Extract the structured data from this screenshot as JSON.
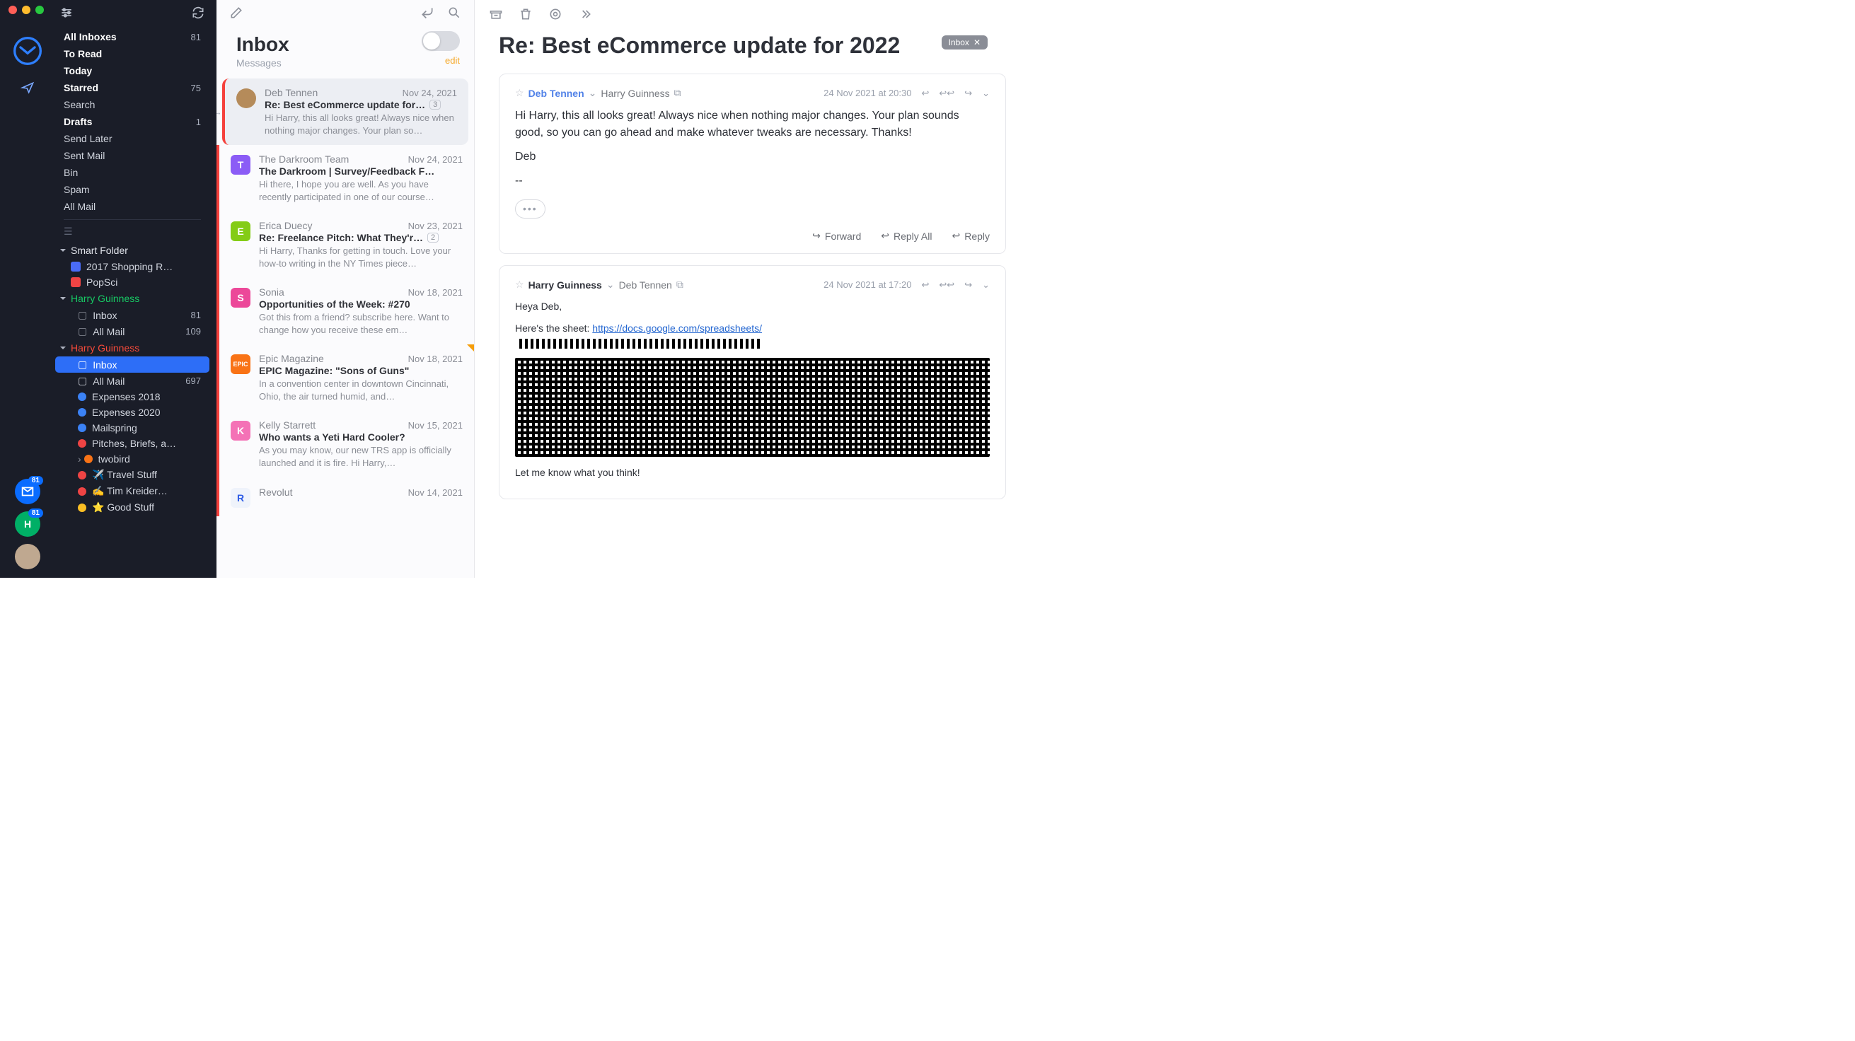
{
  "rail": {
    "badges": {
      "top": "81",
      "mid": "81"
    },
    "mid_avatar_initial": "H"
  },
  "sidebar": {
    "top": [
      {
        "label": "All Inboxes",
        "count": "81",
        "bold": true
      },
      {
        "label": "To Read",
        "count": "",
        "bold": true
      },
      {
        "label": "Today",
        "count": "",
        "bold": true
      },
      {
        "label": "Starred",
        "count": "75",
        "bold": true
      },
      {
        "label": "Search",
        "count": "",
        "bold": false
      },
      {
        "label": "Drafts",
        "count": "1",
        "bold": true
      },
      {
        "label": "Send Later",
        "count": "",
        "bold": false
      },
      {
        "label": "Sent Mail",
        "count": "",
        "bold": false
      },
      {
        "label": "Bin",
        "count": "",
        "bold": false
      },
      {
        "label": "Spam",
        "count": "",
        "bold": false
      },
      {
        "label": "All Mail",
        "count": "",
        "bold": false
      }
    ],
    "smart_label": "Smart Folder",
    "smart": [
      {
        "label": "2017 Shopping R…",
        "color": "sf-blue"
      },
      {
        "label": "PopSci",
        "color": "sf-red"
      }
    ],
    "acct1": {
      "name": "Harry Guinness",
      "items": [
        {
          "label": "Inbox",
          "count": "81"
        },
        {
          "label": "All Mail",
          "count": "109"
        }
      ]
    },
    "acct2": {
      "name": "Harry Guinness",
      "items": [
        {
          "label": "Inbox",
          "count": "",
          "selected": true
        },
        {
          "label": "All Mail",
          "count": "697"
        }
      ],
      "tags": [
        {
          "dot": "d-blue",
          "label": "Expenses 2018"
        },
        {
          "dot": "d-blue",
          "label": "Expenses 2020"
        },
        {
          "dot": "d-blue",
          "label": "Mailspring"
        },
        {
          "dot": "d-red",
          "label": "Pitches, Briefs, a…"
        },
        {
          "dot": "d-orange",
          "label": "twobird",
          "expandable": true
        },
        {
          "dot": "d-red",
          "label": "✈️ Travel Stuff"
        },
        {
          "dot": "d-red",
          "label": "✍️ Tim Kreider…"
        },
        {
          "dot": "d-yellow",
          "label": "⭐️ Good Stuff"
        }
      ]
    }
  },
  "list": {
    "title": "Inbox",
    "subtitle": "Messages",
    "edit": "edit",
    "messages": [
      {
        "from": "Deb Tennen",
        "date": "Nov 24, 2021",
        "subj": "Re: Best eCommerce update for…",
        "count": "3",
        "prev": "Hi Harry, this all looks great! Always nice when nothing major changes. Your plan so…",
        "avatar": "img",
        "color": "#b58b5a",
        "selected": true
      },
      {
        "from": "The Darkroom Team",
        "date": "Nov 24, 2021",
        "subj": "The Darkroom | Survey/Feedback F…",
        "prev": "Hi there, I hope you are well. As you have recently participated in one of our course…",
        "avatar": "T",
        "color": "#8b5cf6"
      },
      {
        "from": "Erica Duecy",
        "date": "Nov 23, 2021",
        "subj": "Re: Freelance Pitch: What They'r…",
        "count": "2",
        "prev": "Hi Harry, Thanks for getting in touch. Love your how-to writing in the NY Times piece…",
        "avatar": "E",
        "color": "#84cc16"
      },
      {
        "from": "Sonia",
        "date": "Nov 18, 2021",
        "subj": "Opportunities of the Week: #270",
        "prev": "Got this from a friend? subscribe here. Want to change how you receive these em…",
        "avatar": "S",
        "color": "#ec4899"
      },
      {
        "from": "Epic Magazine",
        "date": "Nov 18, 2021",
        "subj": "EPIC Magazine: \"Sons of Guns\"",
        "prev": "In a convention center in downtown Cincinnati, Ohio, the air turned humid, and…",
        "avatar": "EPIC",
        "color": "#f97316",
        "small": true,
        "flag": true
      },
      {
        "from": "Kelly Starrett",
        "date": "Nov 15, 2021",
        "subj": "Who wants a Yeti Hard Cooler?",
        "prev": "As you may know, our new TRS app is officially launched and it is fire. Hi Harry,…",
        "avatar": "K",
        "color": "#f472b6"
      },
      {
        "from": "Revolut",
        "date": "Nov 14, 2021",
        "subj": "",
        "prev": "",
        "avatar": "R",
        "color": "#eff3fb",
        "textcolor": "#2e5ce6"
      }
    ]
  },
  "reader": {
    "subject": "Re: Best eCommerce update for 2022",
    "chip": "Inbox",
    "emails": [
      {
        "sender": "Deb Tennen",
        "recipient": "Harry Guinness",
        "date": "24 Nov 2021 at 20:30",
        "body_p1": "Hi Harry, this all looks great! Always nice when nothing major changes. Your plan sounds good, so you can go ahead and make whatever tweaks are necessary. Thanks!",
        "body_p2": "Deb",
        "body_p3": "--",
        "forward": "Forward",
        "reply_all": "Reply All",
        "reply": "Reply"
      },
      {
        "sender": "Harry Guinness",
        "recipient": "Deb Tennen",
        "date": "24 Nov 2021 at 17:20",
        "greet": "Heya Deb,",
        "sheet_intro": "Here's the sheet:",
        "sheet_link": "https://docs.google.com/spreadsheets/",
        "closing": "Let me know what you think!"
      }
    ]
  }
}
